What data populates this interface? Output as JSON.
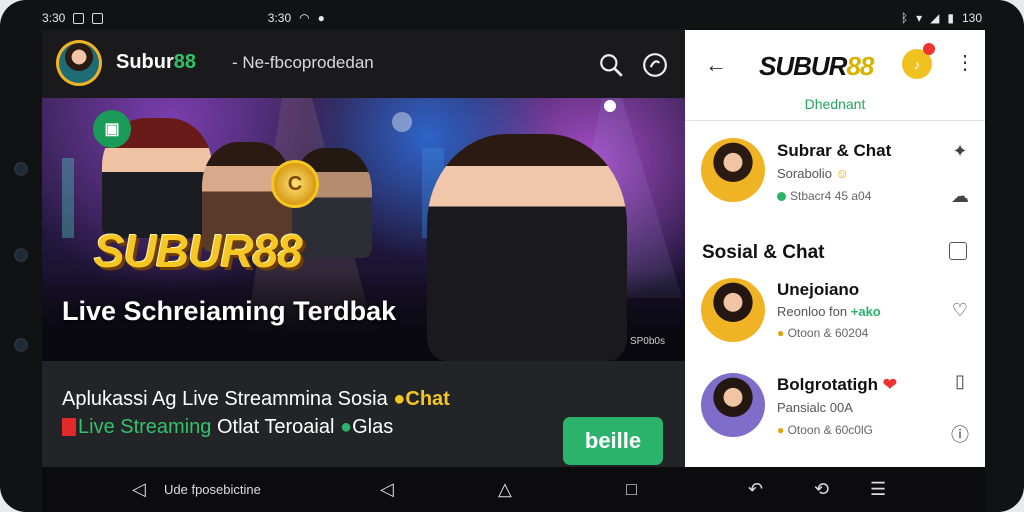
{
  "status_bar": {
    "time_left": "3:30",
    "time_right": "3:30",
    "battery": "130"
  },
  "app": {
    "title_main": "Subur",
    "title_accent": "88",
    "subtitle": "- Ne-fbcoprodedan",
    "icons": {
      "search": "search-icon",
      "notify": "notification-icon"
    }
  },
  "banner": {
    "logo_text": "SUBUR88",
    "headline": "Live Schreiaming Terdbak",
    "watermark": "SP0b0s"
  },
  "content": {
    "line1_text": "Aplukassi Ag Live Streammina Sosia",
    "line1_chat": "Chat",
    "line2_live": "Live Streaming",
    "line2_rest": "Otlat Teroaial",
    "line2_tail": "Glas",
    "cta_label": "beille"
  },
  "panel": {
    "logo_main": "SUBUR",
    "logo_accent": "88",
    "tab_label": "Dhednant",
    "section_title": "Sosial & Chat",
    "items": [
      {
        "name": "Subrar & Chat",
        "msg": "Sorabolio",
        "time": "Stbacr4 45 a04"
      },
      {
        "name": "Unejoiano",
        "msg": "Reonloo fon",
        "msg_badge": "+ako",
        "time": "Otoon & 60204"
      },
      {
        "name": "Bolgrotatigh",
        "msg": "Pansialc 00A",
        "time": "Otoon & 60c0lG"
      }
    ]
  },
  "navbar": {
    "label": "Ude fposebictine"
  }
}
